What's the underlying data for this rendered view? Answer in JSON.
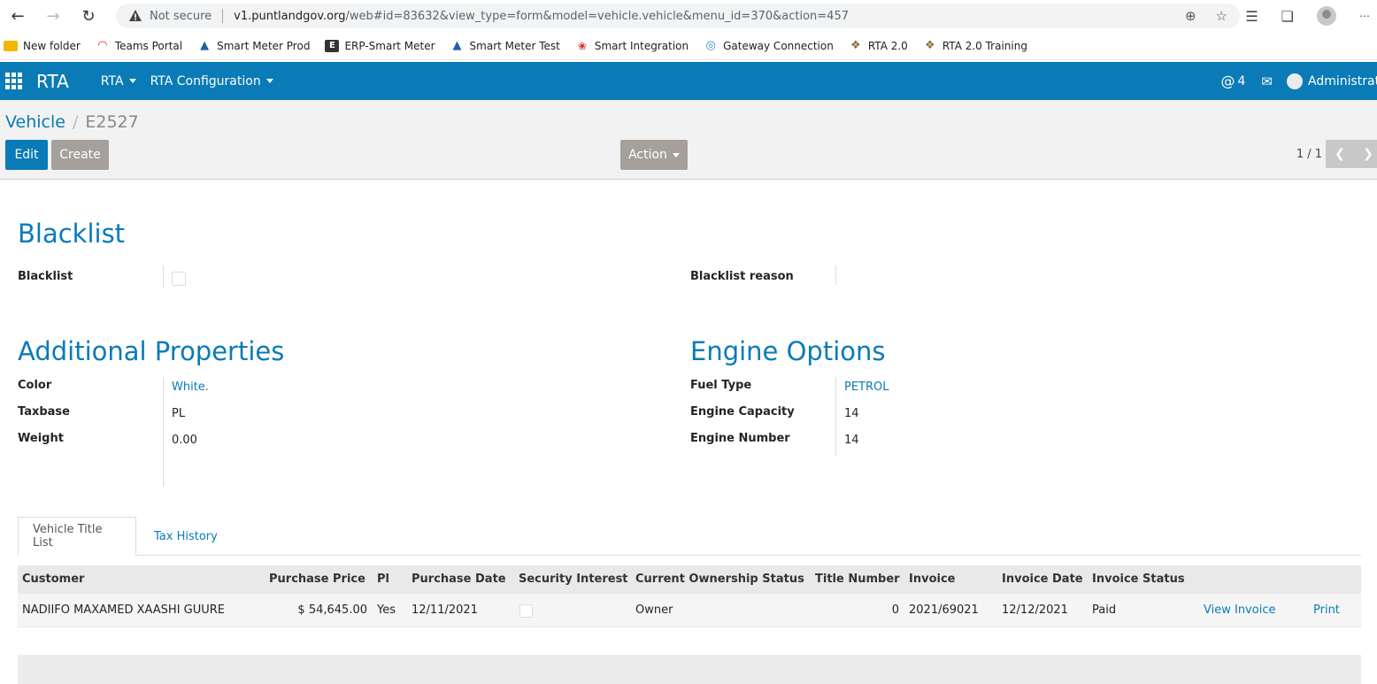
{
  "browser": {
    "not_secure": "Not secure",
    "url_host": "v1.puntlandgov.org",
    "url_rest": "/web#id=83632&view_type=form&model=vehicle.vehicle&menu_id=370&action=457",
    "bookmarks": [
      {
        "label": "New folder",
        "icon": "folder-icon",
        "color": "#f2b705"
      },
      {
        "label": "Teams Portal",
        "icon": "gauge-icon",
        "color": "#d32f2f"
      },
      {
        "label": "Smart Meter Prod",
        "icon": "drop-icon",
        "color": "#1f5fa8"
      },
      {
        "label": "ERP-Smart Meter",
        "icon": "e-icon",
        "color": "#333333"
      },
      {
        "label": "Smart Meter Test",
        "icon": "drop-icon",
        "color": "#1f5fa8"
      },
      {
        "label": "Smart Integration",
        "icon": "huawei-icon",
        "color": "#d32f2f"
      },
      {
        "label": "Gateway Connection",
        "icon": "globe-icon",
        "color": "#2a8fbd"
      },
      {
        "label": "RTA 2.0",
        "icon": "emblem-icon",
        "color": "#8a6d3b"
      },
      {
        "label": "RTA 2.0 Training",
        "icon": "emblem-icon",
        "color": "#8a6d3b"
      }
    ]
  },
  "nav": {
    "brand": "RTA",
    "menus": [
      "RTA",
      "RTA Configuration"
    ],
    "activity_count": "4",
    "user": "Administrator"
  },
  "control": {
    "breadcrumb_parent": "Vehicle",
    "breadcrumb_current": "E2527",
    "edit_label": "Edit",
    "create_label": "Create",
    "action_label": "Action",
    "pager": "1 / 1"
  },
  "form": {
    "blacklist_title": "Blacklist",
    "blacklist_label": "Blacklist",
    "blacklist_reason_label": "Blacklist reason",
    "additional_title": "Additional Properties",
    "color_label": "Color",
    "color_value": "White.",
    "taxbase_label": "Taxbase",
    "taxbase_value": "PL",
    "weight_label": "Weight",
    "weight_value": "0.00",
    "engine_title": "Engine Options",
    "fuel_label": "Fuel Type",
    "fuel_value": "PETROL",
    "capacity_label": "Engine Capacity",
    "capacity_value": "14",
    "engine_number_label": "Engine Number",
    "engine_number_value": "14"
  },
  "tabs": {
    "title_list": "Vehicle Title List",
    "tax_history": "Tax History"
  },
  "table": {
    "headers": [
      "Customer",
      "Purchase Price",
      "Pl",
      "Purchase Date",
      "Security Interest",
      "Current Ownership Status",
      "Title Number",
      "Invoice",
      "Invoice Date",
      "Invoice Status"
    ],
    "row": {
      "customer": "NADIIFO MAXAMED XAASHI GUURE",
      "price": "$ 54,645.00",
      "pl": "Yes",
      "purchase_date": "12/11/2021",
      "ownership": "Owner",
      "title_number": "0",
      "invoice": "2021/69021",
      "invoice_date": "12/12/2021",
      "invoice_status": "Paid",
      "view_invoice": "View Invoice",
      "print": "Print"
    }
  }
}
